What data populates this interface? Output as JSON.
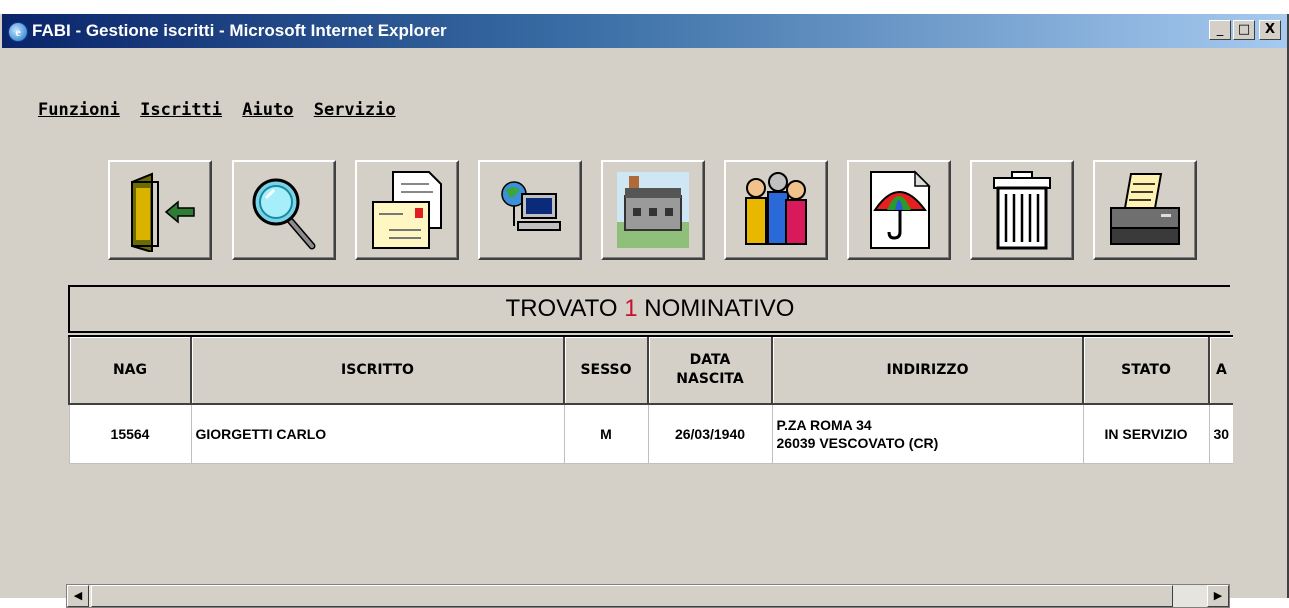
{
  "window": {
    "title": "FABI - Gestione iscritti - Microsoft Internet Explorer",
    "controls": {
      "minimize": "_",
      "maximize": "□",
      "close": "X"
    }
  },
  "menu": [
    "Funzioni",
    "Iscritti",
    "Aiuto",
    "Servizio"
  ],
  "toolbar": [
    {
      "icon": "exit-door-icon"
    },
    {
      "icon": "magnifier-search-icon"
    },
    {
      "icon": "document-mail-icon"
    },
    {
      "icon": "network-computer-icon"
    },
    {
      "icon": "building-icon"
    },
    {
      "icon": "people-group-icon"
    },
    {
      "icon": "umbrella-document-icon"
    },
    {
      "icon": "trash-can-icon"
    },
    {
      "icon": "printer-icon"
    }
  ],
  "banner": {
    "prefix": "TROVATO ",
    "count": "1",
    "suffix": " NOMINATIVO"
  },
  "table": {
    "headers": [
      "NAG",
      "ISCRITTO",
      "SESSO",
      "DATA\nNASCITA",
      "INDIRIZZO",
      "STATO",
      "A"
    ],
    "rows": [
      {
        "nag": "15564",
        "iscritto": "GIORGETTI CARLO",
        "sesso": "M",
        "data_nascita": "26/03/1940",
        "indirizzo_1": "P.ZA ROMA 34",
        "indirizzo_2": "26039 VESCOVATO (CR)",
        "stato": "IN SERVIZIO",
        "extra": "30"
      }
    ]
  },
  "colors": {
    "count_highlight": "#c8102e",
    "window_face": "#d4d0c8",
    "titlebar": "#0a246a"
  }
}
